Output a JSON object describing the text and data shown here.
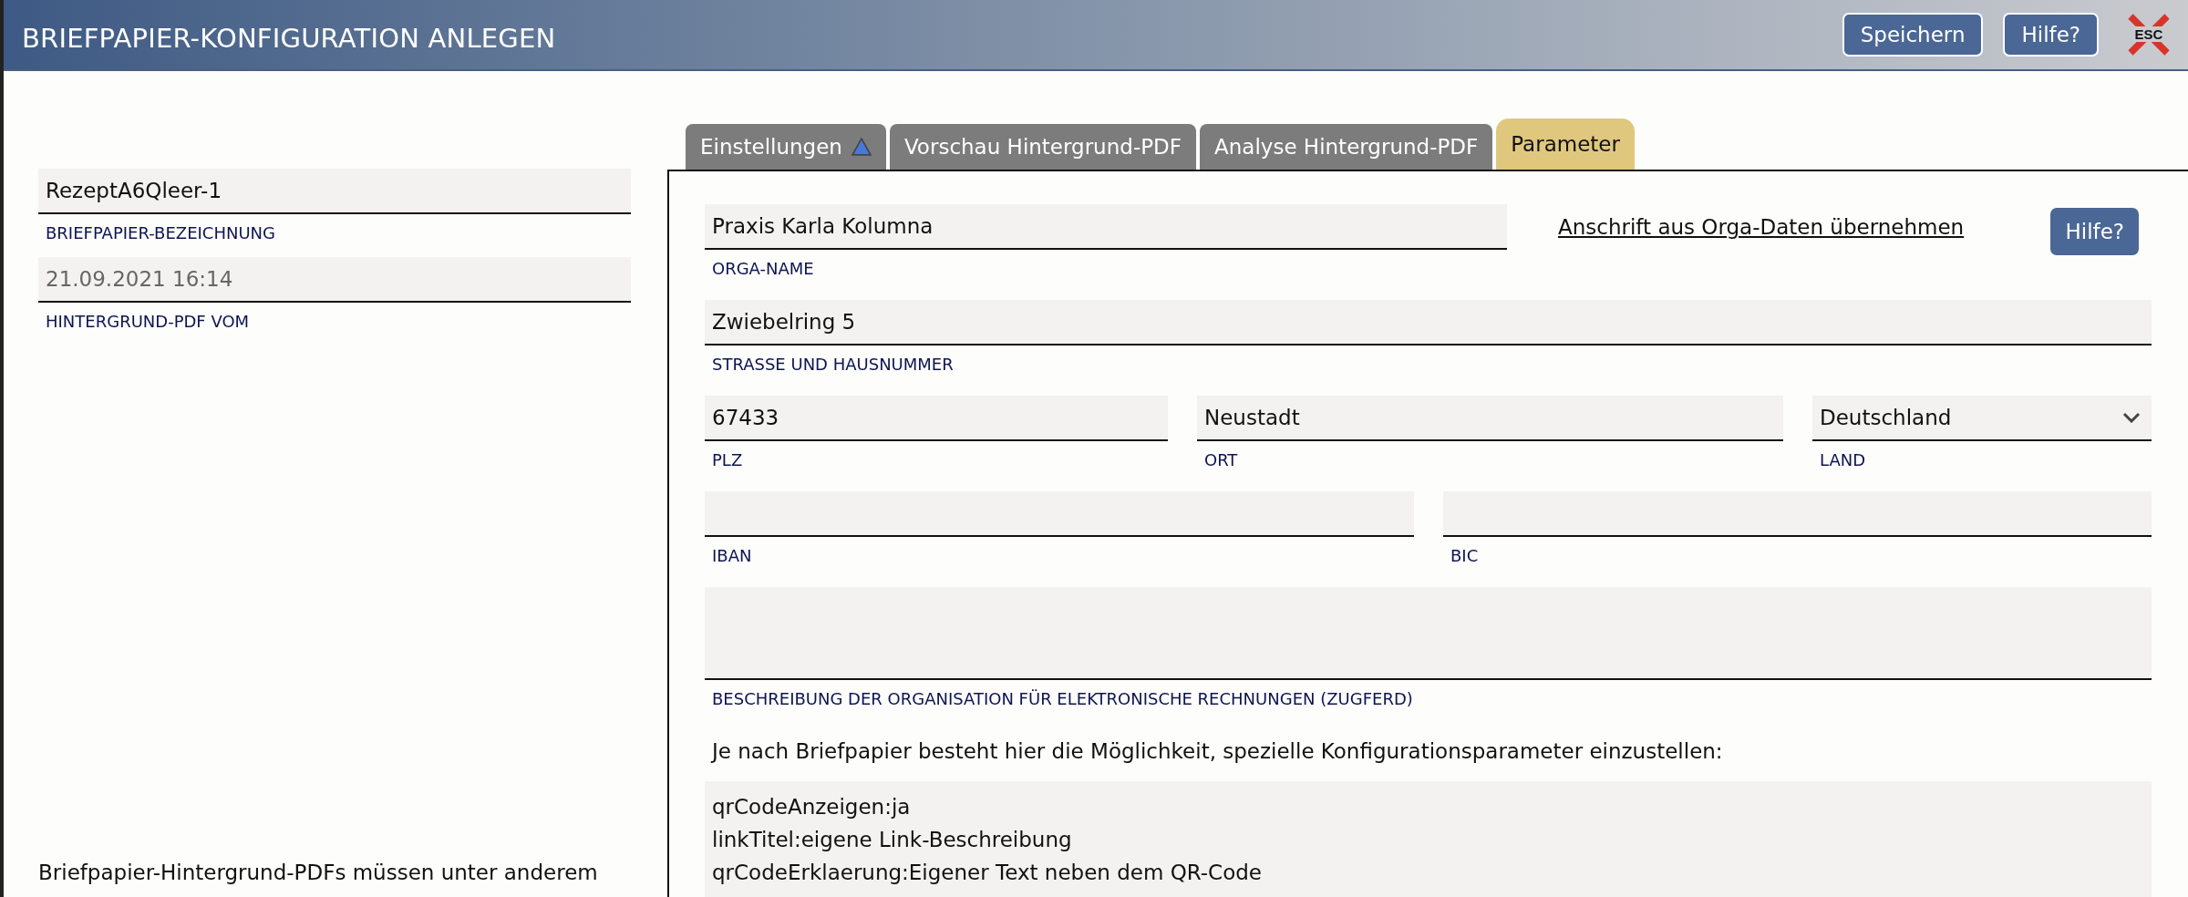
{
  "header": {
    "title": "BRIEFPAPIER-KONFIGURATION ANLEGEN",
    "buttons": [
      "Speichern",
      "Hilfe?"
    ],
    "close_label": "ESC"
  },
  "sidebar": {
    "fields": [
      {
        "kind": "text",
        "value": "RezeptA6Qleer-1",
        "label": "BRIEFPAPIER-BEZEICHNUNG",
        "disabled": false
      },
      {
        "kind": "text",
        "value": "21.09.2021 16:14",
        "label": "HINTERGRUND-PDF VOM",
        "disabled": true
      }
    ],
    "note": "Briefpapier-Hintergrund-PDFs müssen unter anderem"
  },
  "tabs": [
    {
      "label": "Einstellungen",
      "selected": false,
      "indicator": true
    },
    {
      "label": "Vorschau Hintergrund-PDF",
      "selected": false,
      "indicator": false
    },
    {
      "label": "Analyse Hintergrund-PDF",
      "selected": false,
      "indicator": false
    },
    {
      "label": "Parameter",
      "selected": true,
      "indicator": false
    }
  ],
  "panel": {
    "link": "Anschrift aus Orga-Daten übernehmen",
    "help_button": "Hilfe?",
    "rows": [
      [
        {
          "kind": "text",
          "value": "Praxis Karla Kolumna",
          "label": "ORGA-NAME"
        }
      ],
      [
        {
          "kind": "text",
          "value": "Zwiebelring 5",
          "label": "STRASSE UND HAUSNUMMER"
        }
      ],
      [
        {
          "kind": "text",
          "value": "67433",
          "label": "PLZ"
        },
        {
          "kind": "text",
          "value": "Neustadt",
          "label": "ORT"
        },
        {
          "kind": "select",
          "value": "Deutschland",
          "label": "LAND"
        }
      ],
      [
        {
          "kind": "text",
          "label": "IBAN"
        },
        {
          "kind": "text",
          "label": "BIC"
        }
      ],
      [
        {
          "kind": "textarea",
          "label": "BESCHREIBUNG DER ORGANISATION FÜR ELEKTRONISCHE RECHNUNGEN (ZUGFERD)"
        }
      ]
    ],
    "intro": "Je nach Briefpapier besteht hier die Möglichkeit, spezielle Konfigurationsparameter einzustellen:",
    "parameters": [
      "qrCodeAnzeigen:ja",
      "linkTitel:eigene Link-Beschreibung",
      "qrCodeErklaerung:Eigener Text neben dem QR-Code"
    ]
  }
}
